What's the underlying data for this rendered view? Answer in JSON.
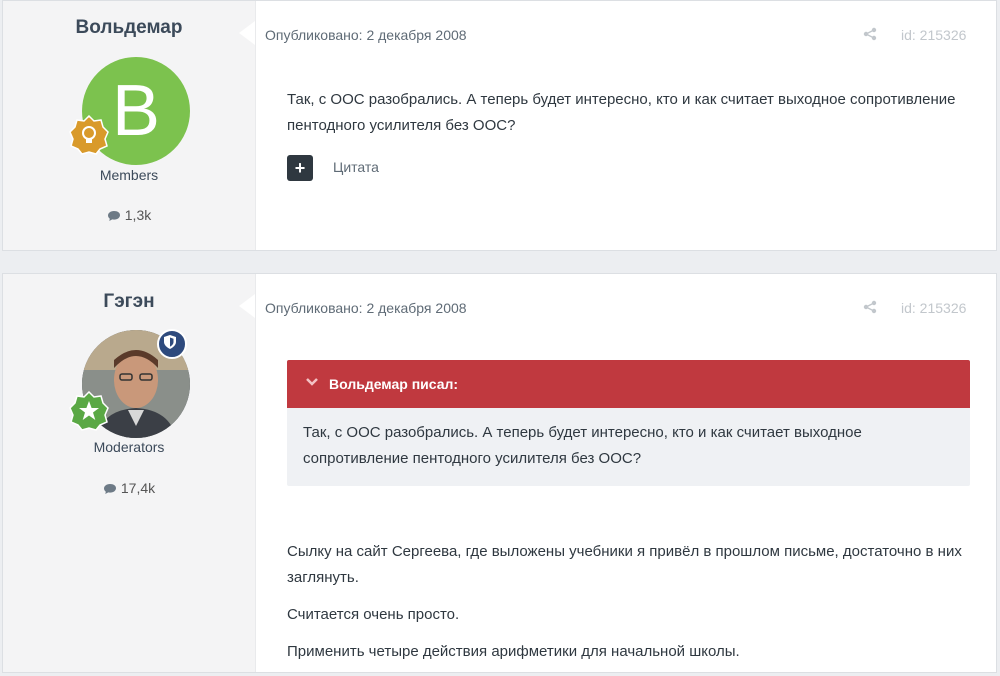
{
  "posts": [
    {
      "author": "Вольдемар",
      "avatar_letter": "В",
      "avatar_color": "#7cc24e",
      "group": "Members",
      "post_count": "1,3k",
      "meta": "Опубликовано: 2 декабря 2008",
      "id_label": "id: 215326",
      "content": "Так, с ООС разобрались. А теперь будет интересно, кто и как считает выходное сопротивление пентодного усилителя без ООС?",
      "quote_label": "Цитата",
      "quote_btn": "+"
    },
    {
      "author": "Гэгэн",
      "group": "Moderators",
      "post_count": "17,4k",
      "meta": "Опубликовано: 2 декабря 2008",
      "id_label": "id: 215326",
      "quote": {
        "author": "Вольдемар писал:",
        "text": "Так, с ООС разобрались. А теперь будет интересно, кто и как считает выходное сопротивление пентодного усилителя без ООС?"
      },
      "paragraphs": [
        "Сылку на сайт Сергеева, где выложены учебники я привёл в прошлом письме, достаточно в них заглянуть.",
        "Считается очень просто.",
        "Применить четыре действия арифметики для начальной школы."
      ]
    }
  ],
  "colors": {
    "quote_header": "#c0393f",
    "moderator_badge": "#2e4a7d",
    "rank_badge_gold": "#d99a2b",
    "rank_badge_green": "#5aa845"
  },
  "icons": {
    "share": "share-icon",
    "chat": "chat-bubble-icon",
    "rank_gold": "lightbulb-badge-icon",
    "rank_green": "star-badge-icon",
    "moderator": "shield-icon",
    "chevron": "chevron-down-icon"
  }
}
